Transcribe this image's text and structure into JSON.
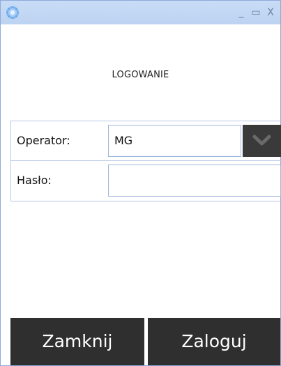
{
  "titlebar": {
    "app_icon": "flower-logo-icon",
    "minimize": "_",
    "maximize": "▭",
    "close": "X"
  },
  "screen": {
    "title": "LOGOWANIE"
  },
  "form": {
    "operator_label": "Operator:",
    "operator_value": "MG",
    "password_label": "Hasło:",
    "password_value": ""
  },
  "footer": {
    "close_label": "Zamknij",
    "login_label": "Zaloguj"
  },
  "colors": {
    "titlebar": "#c8dcf6",
    "button_bg": "#2f2f2f",
    "border": "#b8c8e4"
  }
}
